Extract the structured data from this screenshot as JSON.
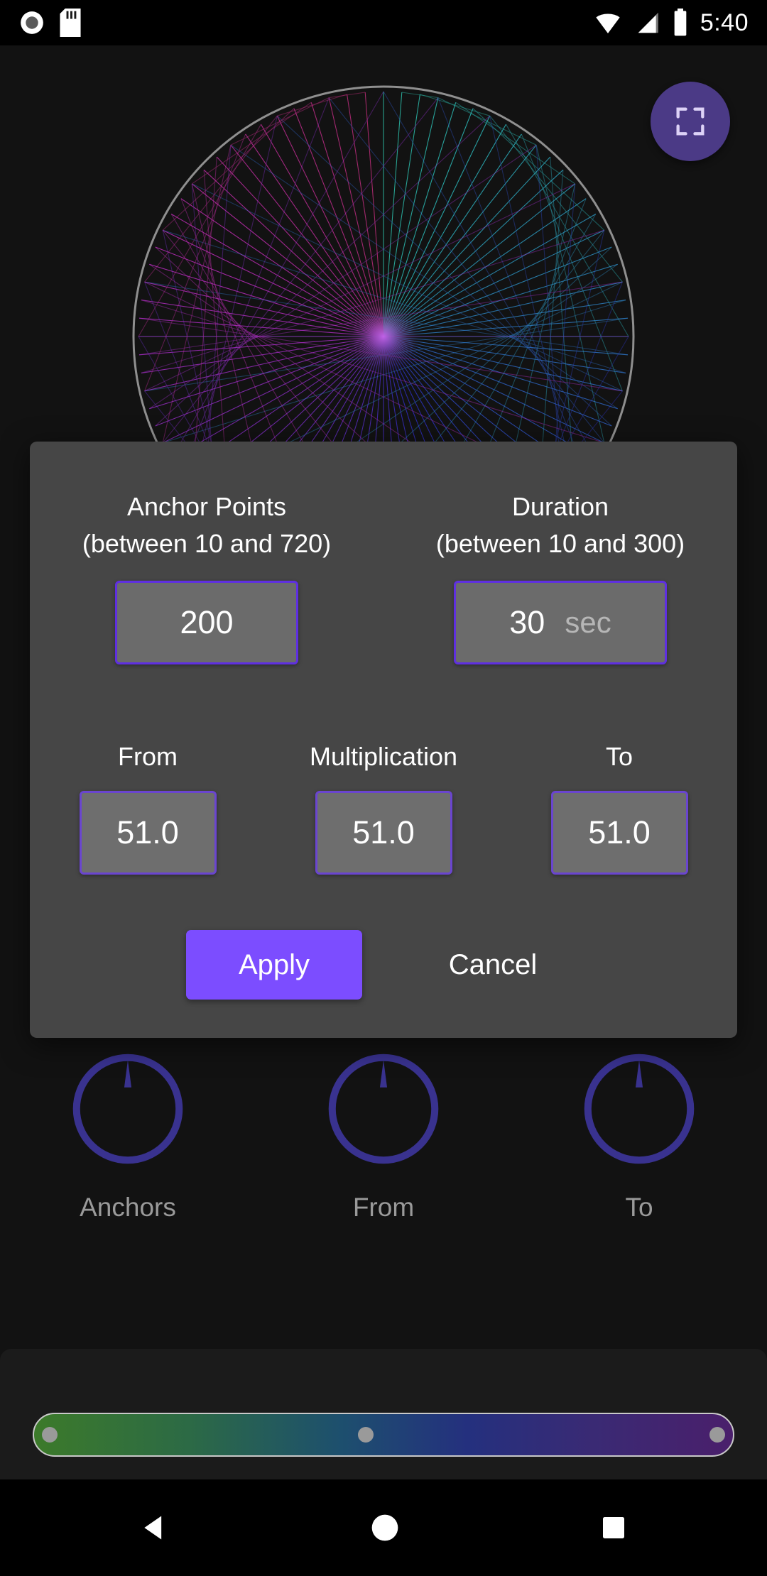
{
  "statusbar": {
    "time": "5:40",
    "icons": [
      "record-icon",
      "sd-card-icon",
      "wifi-icon",
      "cellular-signal-icon",
      "battery-icon"
    ]
  },
  "fab": {
    "icon": "fullscreen-icon"
  },
  "dialog": {
    "anchor": {
      "label_line1": "Anchor Points",
      "label_line2": "(between 10 and 720)",
      "value": "200"
    },
    "duration": {
      "label_line1": "Duration",
      "label_line2": "(between 10 and 300)",
      "value": "30",
      "unit": "sec"
    },
    "from": {
      "label": "From",
      "value": "51.0"
    },
    "multiplication": {
      "label": "Multiplication",
      "value": "51.0"
    },
    "to": {
      "label": "To",
      "value": "51.0"
    },
    "apply_label": "Apply",
    "cancel_label": "Cancel",
    "accent_color": "#7c4dff",
    "field_border_color": "#5f2fe0",
    "background_color": "#464646"
  },
  "knobs": [
    {
      "label": "Anchors",
      "name": "knob-anchors",
      "angle": 0
    },
    {
      "label": "From",
      "name": "knob-from",
      "angle": 0
    },
    {
      "label": "To",
      "name": "knob-to",
      "angle": 0
    }
  ],
  "slider": {
    "name": "color-gradient-slider",
    "handles": [
      2,
      47,
      98
    ],
    "gradient_stops": [
      "#3c7a2a",
      "#2c6a45",
      "#1d4f6e",
      "#24307e",
      "#3a2a74",
      "#4a1f6b"
    ]
  },
  "navbar": {
    "back": "back-triangle-icon",
    "home": "home-circle-icon",
    "recents": "recents-square-icon"
  }
}
